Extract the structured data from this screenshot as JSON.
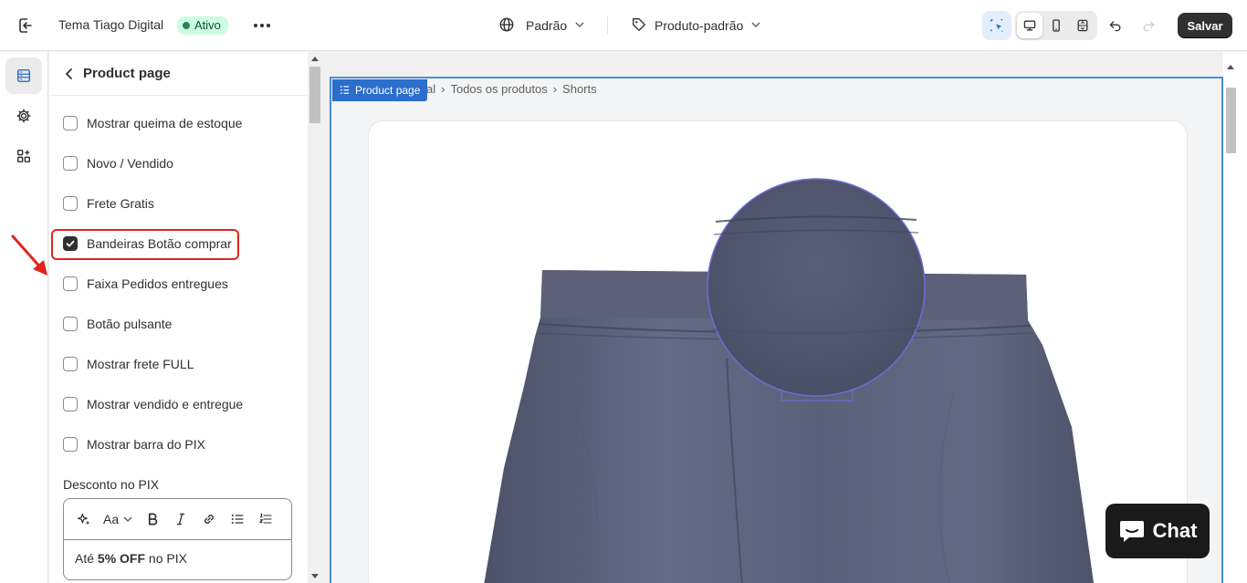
{
  "topbar": {
    "theme_name": "Tema Tiago Digital",
    "status_badge": "Ativo",
    "language": "Padrão",
    "template": "Produto-padrão",
    "save_label": "Salvar"
  },
  "sidebar_panel": {
    "title": "Product page",
    "checkboxes": [
      {
        "label": "Mostrar queima de estoque",
        "checked": false
      },
      {
        "label": "Novo / Vendido",
        "checked": false
      },
      {
        "label": "Frete Gratis",
        "checked": false
      },
      {
        "label": "Bandeiras Botão comprar",
        "checked": true
      },
      {
        "label": "Faixa Pedidos entregues",
        "checked": false
      },
      {
        "label": "Botão pulsante",
        "checked": false
      },
      {
        "label": "Mostrar frete FULL",
        "checked": false
      },
      {
        "label": "Mostrar vendido e entregue",
        "checked": false
      },
      {
        "label": "Mostrar barra do PIX",
        "checked": false
      }
    ],
    "pix_field": {
      "label": "Desconto no PIX",
      "value_prefix": "Até ",
      "value_bold": "5% OFF",
      "value_suffix": " no PIX",
      "format_label": "Aa"
    }
  },
  "preview": {
    "section_tag": "Product page",
    "breadcrumbs": [
      "al",
      "Todos os produtos",
      "Shorts"
    ],
    "chat_label": "Chat"
  },
  "colors": {
    "accent": "#2c6ecb",
    "highlight": "#e0241d",
    "badge_bg": "#cdfee1",
    "product": "#5b6079"
  }
}
